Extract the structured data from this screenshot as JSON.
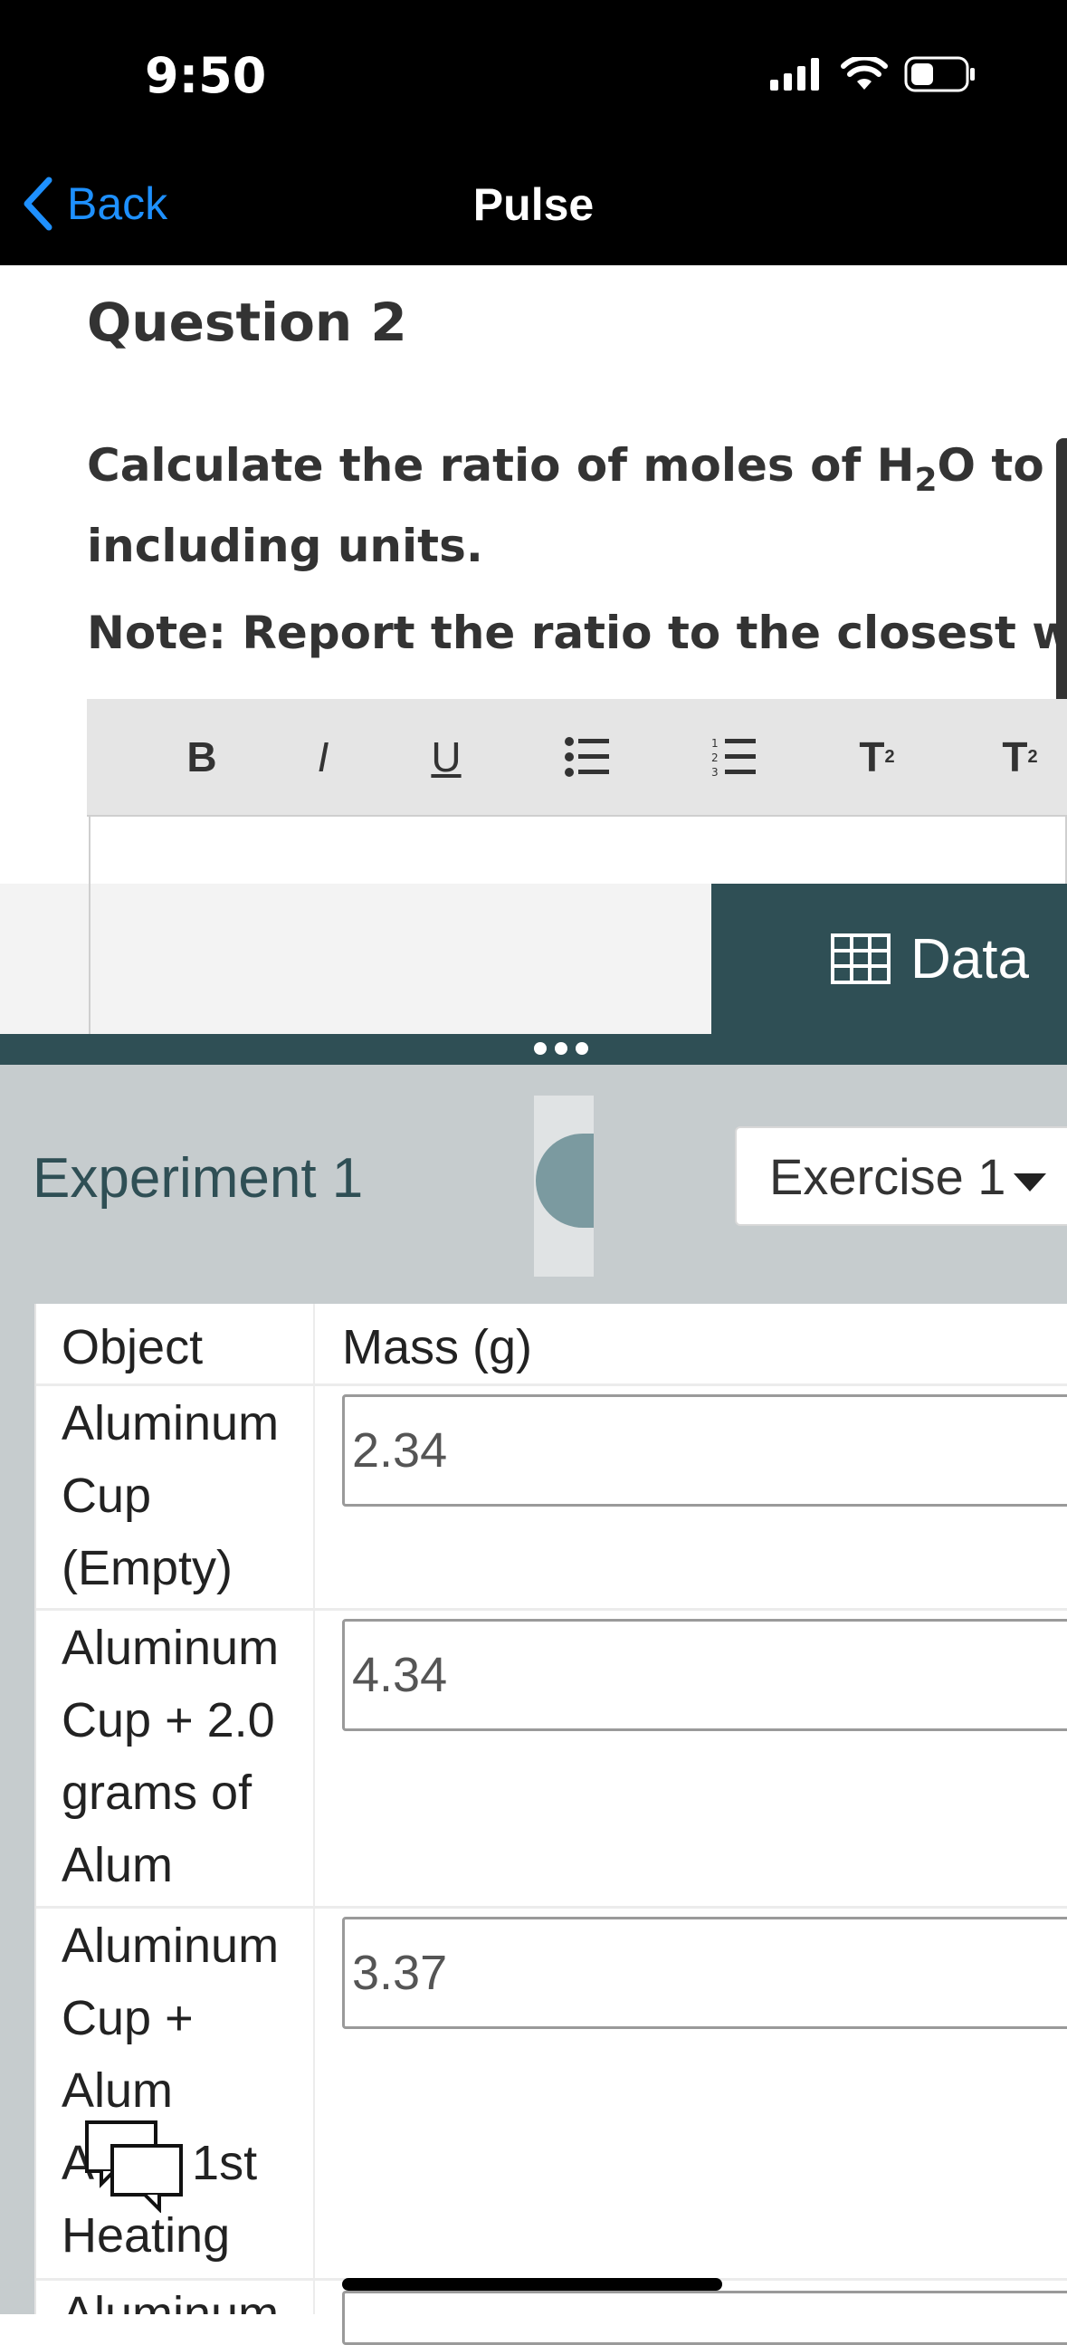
{
  "status_bar": {
    "time": "9:50"
  },
  "nav": {
    "back_label": "Back",
    "title": "Pulse"
  },
  "question": {
    "title": "Question 2",
    "text_line1_prefix": "Calculate the ratio of moles of H",
    "text_sub": "2",
    "text_line1_suffix": "O to mol",
    "text_line2": "including units.",
    "note": "Note: Report the ratio to the closest whole"
  },
  "toolbar": {
    "bold": "B",
    "italic": "I",
    "underline": "U",
    "superscript": "T",
    "subscript": "T"
  },
  "data_button": {
    "label": "Data"
  },
  "experiment": {
    "title": "Experiment 1",
    "exercise_selected": "Exercise 1"
  },
  "table": {
    "headers": [
      "Object",
      "Mass (g)"
    ],
    "rows": [
      {
        "label_lines": [
          "Aluminum",
          "Cup",
          "(Empty)"
        ],
        "value": "2.34"
      },
      {
        "label_lines": [
          "Aluminum",
          "Cup + 2.0",
          "grams of",
          "Alum"
        ],
        "value": "4.34"
      },
      {
        "label_lines": [
          "Aluminum",
          "Cup +",
          "Alum",
          "A",
          "1st",
          "Heating"
        ],
        "value": "3.37"
      }
    ],
    "partial_label": "Aluminum"
  }
}
